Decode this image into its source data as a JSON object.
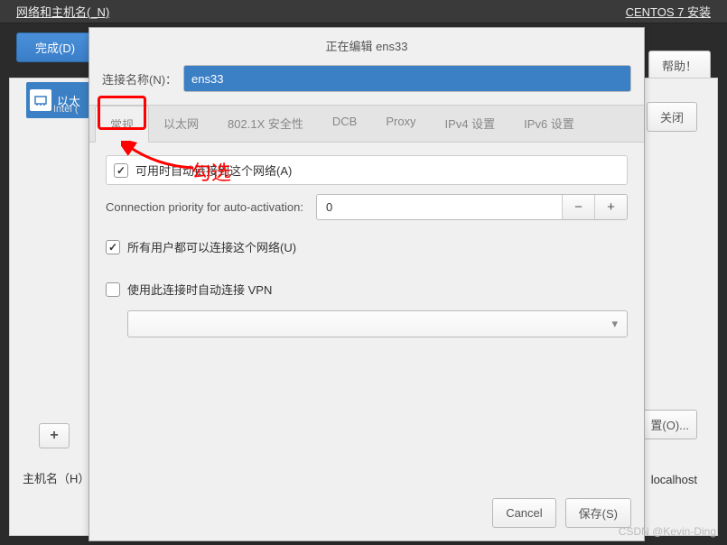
{
  "header": {
    "title": "网络和主机名(_N)",
    "right": "CENTOS 7 安装"
  },
  "topbar": {
    "done": "完成(D)",
    "help": "帮助！"
  },
  "bg": {
    "eth": "以太",
    "intel": "Intel (",
    "plus": "+",
    "close": "关闭",
    "config": "置(O)...",
    "hostname": "主机名（H）",
    "localhost": "localhost"
  },
  "dialog": {
    "title": "正在编辑 ens33",
    "conn_label": "连接名称(N)：",
    "conn_value": "ens33",
    "tabs": [
      "常规",
      "以太网",
      "802.1X 安全性",
      "DCB",
      "Proxy",
      "IPv4 设置",
      "IPv6 设置"
    ],
    "auto_connect": "可用时自动链接到这个网络(A)",
    "prio_label": "Connection priority for auto-activation:",
    "prio_value": "0",
    "all_users": "所有用户都可以连接这个网络(U)",
    "auto_vpn": "使用此连接时自动连接 VPN",
    "cancel": "Cancel",
    "save": "保存(S)"
  },
  "annot": {
    "check": "勾选"
  },
  "watermark": "CSDN @Kevin-Ding"
}
